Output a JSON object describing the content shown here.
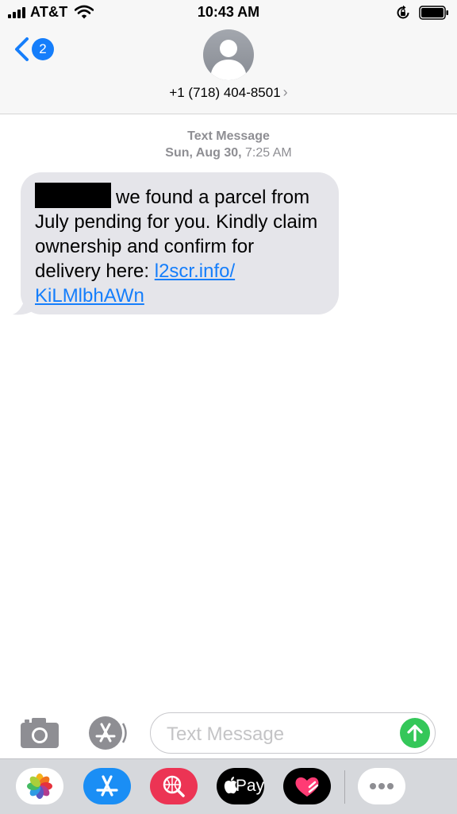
{
  "status_bar": {
    "carrier": "AT&T",
    "time": "10:43 AM",
    "signal_bars": 4,
    "icons": [
      "signal-bars-icon",
      "wifi-icon",
      "orientation-lock-icon",
      "battery-icon"
    ]
  },
  "nav": {
    "back_badge": "2",
    "contact_number": "+1 (718) 404-8501",
    "contact_chevron": "›"
  },
  "conversation": {
    "service_label": "Text Message",
    "date_day": "Sun, Aug 30,",
    "date_time": " 7:25 AM",
    "message": {
      "text_line1": "we found a parcel from",
      "text_rest": "July pending for you. Kindly claim ownership and confirm for delivery here: ",
      "link_line1": "l2scr.info/",
      "link_line2": "KiLMlbhAWn",
      "redacted": true
    }
  },
  "composer": {
    "placeholder": "Text Message"
  },
  "app_drawer": {
    "apps": [
      "photos-app-icon",
      "app-store-app-icon",
      "web-search-app-icon",
      "apple-pay-app-icon",
      "digital-touch-app-icon",
      "more-apps-icon"
    ],
    "apple_pay_label": "Pay"
  },
  "colors": {
    "accent": "#157efb",
    "bubble": "#e5e5ea",
    "send": "#34c759",
    "header_bg": "#f7f7f7",
    "meta_text": "#8e8e93"
  }
}
